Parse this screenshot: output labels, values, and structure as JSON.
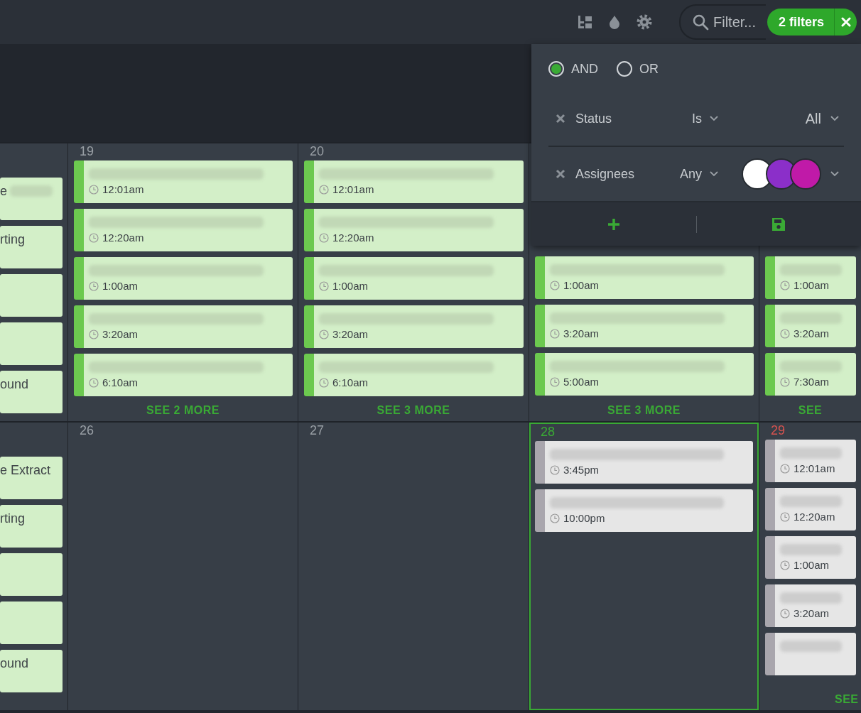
{
  "toolbar": {
    "search": {
      "placeholder": "Filter..."
    },
    "filter_badge": {
      "label": "2 filters"
    }
  },
  "filter_panel": {
    "logic": [
      {
        "label": "AND",
        "selected": true
      },
      {
        "label": "OR",
        "selected": false
      }
    ],
    "rules": [
      {
        "field": "Status",
        "operator": "Is",
        "value": "All"
      },
      {
        "field": "Assignees",
        "operator": "Any",
        "avatars": [
          {
            "color": "#ffffff"
          },
          {
            "color": "#8b2fc9"
          },
          {
            "color": "#c01aa8"
          }
        ]
      }
    ]
  },
  "calendar": {
    "weeks": [
      {
        "days": [
          {
            "events": [
              {
                "kind": "complete",
                "title": "e",
                "blurred": true
              },
              {
                "kind": "complete",
                "title": "rting",
                "blurred": false
              },
              {
                "kind": "complete",
                "blurred": false
              },
              {
                "kind": "complete",
                "blurred": false
              },
              {
                "kind": "complete",
                "title": "ound",
                "blurred": false
              }
            ]
          },
          {
            "number": "19",
            "kind": "normal",
            "events": [
              {
                "kind": "complete",
                "blurred": true,
                "time": "12:01am"
              },
              {
                "kind": "complete",
                "blurred": true,
                "time": "12:20am"
              },
              {
                "kind": "complete",
                "blurred": true,
                "time": "1:00am"
              },
              {
                "kind": "complete",
                "blurred": true,
                "time": "3:20am"
              },
              {
                "kind": "complete",
                "blurred": true,
                "time": "6:10am"
              }
            ],
            "more": "SEE 2 MORE"
          },
          {
            "number": "20",
            "kind": "normal",
            "events": [
              {
                "kind": "complete",
                "blurred": true,
                "time": "12:01am"
              },
              {
                "kind": "complete",
                "blurred": true,
                "time": "12:20am"
              },
              {
                "kind": "complete",
                "blurred": true,
                "time": "1:00am"
              },
              {
                "kind": "complete",
                "blurred": true,
                "time": "3:20am"
              },
              {
                "kind": "complete",
                "blurred": true,
                "time": "6:10am"
              }
            ],
            "more": "SEE 3 MORE"
          },
          {
            "events": [
              {
                "kind": "complete",
                "blurred": true,
                "time": "1:00am"
              },
              {
                "kind": "complete",
                "blurred": true,
                "time": "3:20am"
              },
              {
                "kind": "complete",
                "blurred": true,
                "time": "5:00am"
              }
            ],
            "more": "SEE 3 MORE"
          },
          {
            "events": [
              {
                "kind": "complete",
                "blurred": true,
                "time": "1:00am"
              },
              {
                "kind": "complete",
                "blurred": true,
                "time": "3:20am"
              },
              {
                "kind": "complete",
                "blurred": true,
                "time": "7:30am"
              }
            ],
            "more": "SEE"
          }
        ]
      },
      {
        "days": [
          {
            "events": [
              {
                "kind": "complete",
                "title": "e Extract",
                "blurred": false
              },
              {
                "kind": "complete",
                "title": "rting",
                "blurred": false
              },
              {
                "kind": "complete",
                "blurred": false
              },
              {
                "kind": "complete",
                "blurred": false
              },
              {
                "kind": "complete",
                "title": "ound",
                "blurred": false
              }
            ]
          },
          {
            "number": "26",
            "kind": "normal"
          },
          {
            "number": "27",
            "kind": "normal"
          },
          {
            "number": "28",
            "kind": "today",
            "events": [
              {
                "kind": "scheduled",
                "blurred": true,
                "time": "3:45pm"
              },
              {
                "kind": "scheduled",
                "blurred": true,
                "time": "10:00pm"
              }
            ]
          },
          {
            "number": "29",
            "kind": "holiday",
            "events": [
              {
                "kind": "scheduled",
                "blurred": true,
                "time": "12:01am"
              },
              {
                "kind": "scheduled",
                "blurred": true,
                "time": "12:20am"
              },
              {
                "kind": "scheduled",
                "blurred": true,
                "time": "1:00am"
              },
              {
                "kind": "scheduled",
                "blurred": true,
                "time": "3:20am"
              },
              {
                "kind": "scheduled",
                "blurred": true
              }
            ],
            "more": "SEE"
          }
        ]
      }
    ]
  }
}
